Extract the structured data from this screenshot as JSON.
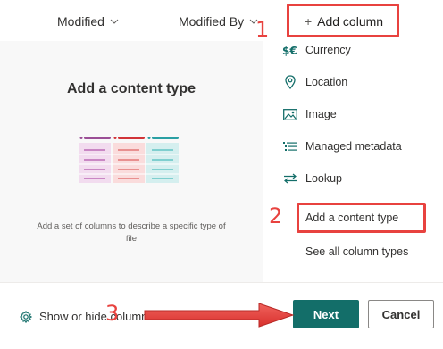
{
  "header": {
    "modified_label": "Modified",
    "modified_by_label": "Modified By",
    "add_column_label": "Add column",
    "add_column_icon": "plus-icon"
  },
  "left_panel": {
    "title": "Add a content type",
    "description": "Add a set of columns to describe a specific type of file",
    "illustration_colors": [
      "#9b4f96",
      "#d13438",
      "#2aa0a4"
    ]
  },
  "menu": {
    "items": [
      {
        "label": "Currency",
        "icon": "currency-icon"
      },
      {
        "label": "Location",
        "icon": "location-pin-icon"
      },
      {
        "label": "Image",
        "icon": "image-icon"
      },
      {
        "label": "Managed metadata",
        "icon": "managed-metadata-icon"
      },
      {
        "label": "Lookup",
        "icon": "lookup-icon"
      },
      {
        "label": "Add a content type",
        "icon": ""
      },
      {
        "label": "See all column types",
        "icon": ""
      }
    ]
  },
  "footer": {
    "show_hide_label": "Show or hide columns",
    "next_label": "Next",
    "cancel_label": "Cancel"
  },
  "annotations": {
    "step1": "1",
    "step2": "2",
    "step3": "3",
    "color": "#e8423f"
  },
  "colors": {
    "primary": "#136e69",
    "panel_bg": "#f8f8f8"
  }
}
